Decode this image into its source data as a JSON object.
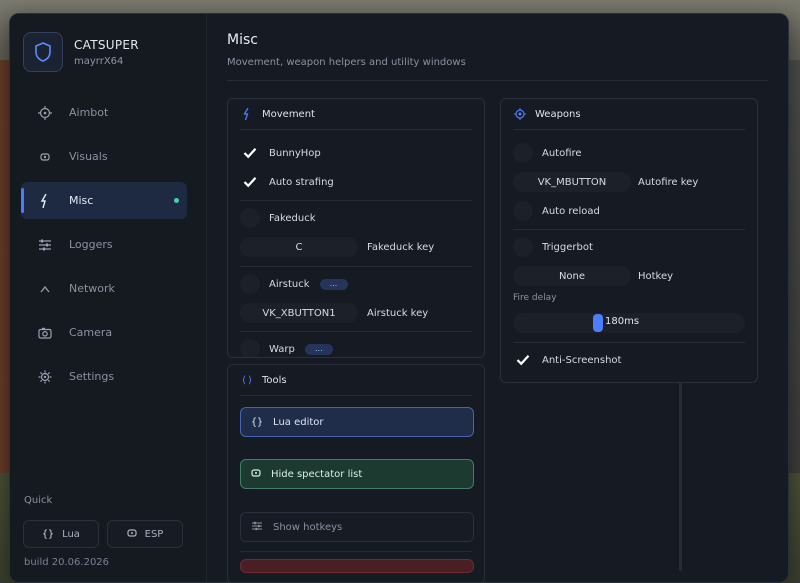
{
  "app": {
    "name": "CATSUPER",
    "user": "mayrrX64",
    "build": "build 20.06.2026"
  },
  "sidebar": {
    "items": [
      {
        "label": "Aimbot",
        "icon": "crosshair-icon"
      },
      {
        "label": "Visuals",
        "icon": "eye-icon"
      },
      {
        "label": "Misc",
        "icon": "bolt-icon",
        "active": true
      },
      {
        "label": "Loggers",
        "icon": "sliders-icon"
      },
      {
        "label": "Network",
        "icon": "wifi-icon"
      },
      {
        "label": "Camera",
        "icon": "camera-icon"
      },
      {
        "label": "Settings",
        "icon": "gear-icon"
      }
    ],
    "quick_label": "Quick",
    "quick": [
      {
        "label": "Lua",
        "icon": "braces-icon"
      },
      {
        "label": "ESP",
        "icon": "eye-icon"
      }
    ]
  },
  "page": {
    "title": "Misc",
    "subtitle": "Movement, weapon helpers and utility windows"
  },
  "movement": {
    "title": "Movement",
    "bunnyhop": "BunnyHop",
    "autostrafing": "Auto strafing",
    "fakeduck": "Fakeduck",
    "fakeduck_key_value": "C",
    "fakeduck_key_label": "Fakeduck key",
    "airstuck": "Airstuck",
    "airstuck_more": "...",
    "airstuck_key_value": "VK_XBUTTON1",
    "airstuck_key_label": "Airstuck key",
    "warp": "Warp",
    "warp_more": "..."
  },
  "tools": {
    "title": "Tools",
    "lua_editor": "Lua editor",
    "hide_spectator": "Hide spectator list",
    "show_hotkeys": "Show hotkeys"
  },
  "weapons": {
    "title": "Weapons",
    "autofire": "Autofire",
    "autofire_key_value": "VK_MBUTTON",
    "autofire_key_label": "Autofire key",
    "autoreload": "Auto reload",
    "triggerbot": "Triggerbot",
    "trigger_key_value": "None",
    "trigger_key_label": "Hotkey",
    "fire_delay_label": "Fire delay",
    "fire_delay_value": "180ms",
    "fire_delay_level": 0.36,
    "antiscreenshot": "Anti-Screenshot"
  },
  "colors": {
    "accent": "#4d7dff",
    "active_dot": "#3fd6a5",
    "panel_bg": "#161a22"
  }
}
